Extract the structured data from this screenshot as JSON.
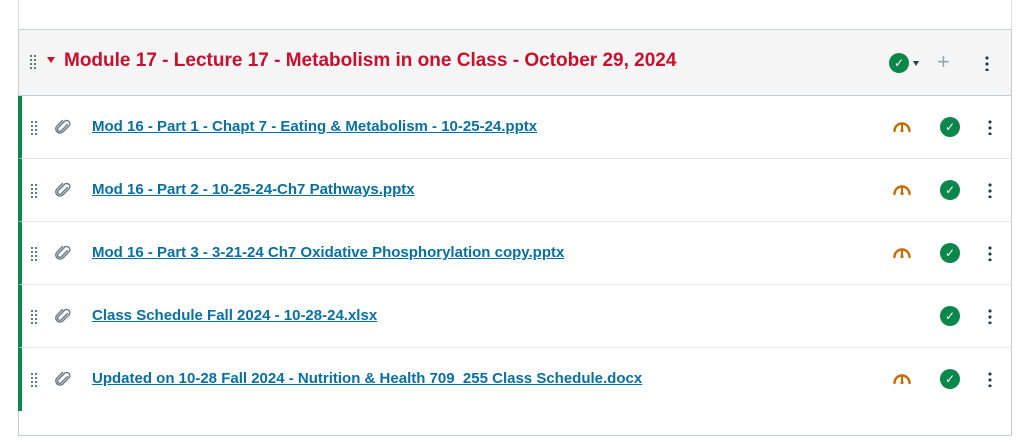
{
  "module": {
    "title": "Module 17 - Lecture 17 - Metabolism in one Class - October 29, 2024",
    "published": true,
    "icons": {
      "drag": "drag-handle-icon",
      "collapse": "caret-down-icon",
      "publish": "check-circle-icon",
      "add": "plus-icon",
      "menu": "kebab-menu-icon"
    },
    "add_label": "+"
  },
  "items": [
    {
      "title": "Mod 16 - Part 1 - Chapt 7 - Eating & Metabolism - 10-25-24.pptx",
      "type_icon": "paperclip-icon",
      "mastery_icon": true,
      "published": true
    },
    {
      "title": "Mod 16 - Part 2 - 10-25-24-Ch7 Pathways.pptx",
      "type_icon": "paperclip-icon",
      "mastery_icon": true,
      "published": true
    },
    {
      "title": "Mod 16 - Part 3 - 3-21-24 Ch7 Oxidative Phosphorylation copy.pptx",
      "type_icon": "paperclip-icon",
      "mastery_icon": true,
      "published": true
    },
    {
      "title": "Class Schedule Fall 2024 - 10-28-24.xlsx",
      "type_icon": "paperclip-icon",
      "mastery_icon": false,
      "published": true
    },
    {
      "title": "Updated on 10-28 Fall 2024 - Nutrition & Health 709_255 Class Schedule.docx",
      "type_icon": "paperclip-icon",
      "mastery_icon": true,
      "published": true
    }
  ],
  "colors": {
    "module_title": "#c8102e",
    "link": "#0770a3",
    "published_green": "#0b874b",
    "gauge_orange": "#c76b00"
  }
}
